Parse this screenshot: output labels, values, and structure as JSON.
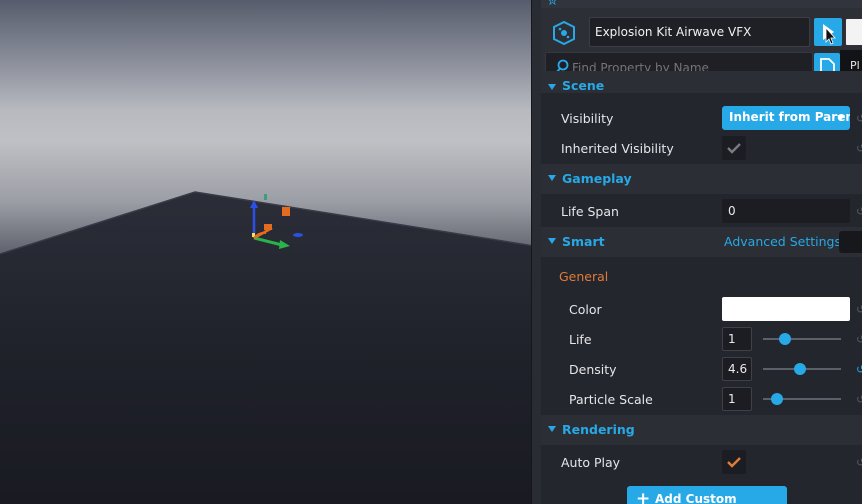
{
  "header": {
    "object_name": "Explosion Kit Airwave VFX",
    "search_placeholder": "Find Property by Name",
    "tooltip": "Pl"
  },
  "sections": {
    "scene": {
      "title": "Scene"
    },
    "gameplay": {
      "title": "Gameplay"
    },
    "smart": {
      "title": "Smart",
      "advanced_link": "Advanced Settings",
      "group": "General"
    },
    "rendering": {
      "title": "Rendering"
    }
  },
  "properties": {
    "visibility": {
      "label": "Visibility",
      "value": "Inherit from Parent"
    },
    "inherited_visibility": {
      "label": "Inherited Visibility",
      "checked": true
    },
    "life_span": {
      "label": "Life Span",
      "value": "0"
    },
    "color": {
      "label": "Color",
      "value": "#ffffff"
    },
    "life": {
      "label": "Life",
      "value": "1",
      "slider_fraction": 0.28
    },
    "density": {
      "label": "Density",
      "value": "4.6",
      "slider_fraction": 0.47
    },
    "particle_scale": {
      "label": "Particle Scale",
      "value": "1",
      "slider_fraction": 0.18
    },
    "auto_play": {
      "label": "Auto Play",
      "checked": true
    }
  },
  "footer": {
    "add_button": "Add Custom Property"
  },
  "colors": {
    "accent": "#27a9e7",
    "orange": "#e07b39",
    "panel": "#24262d"
  }
}
